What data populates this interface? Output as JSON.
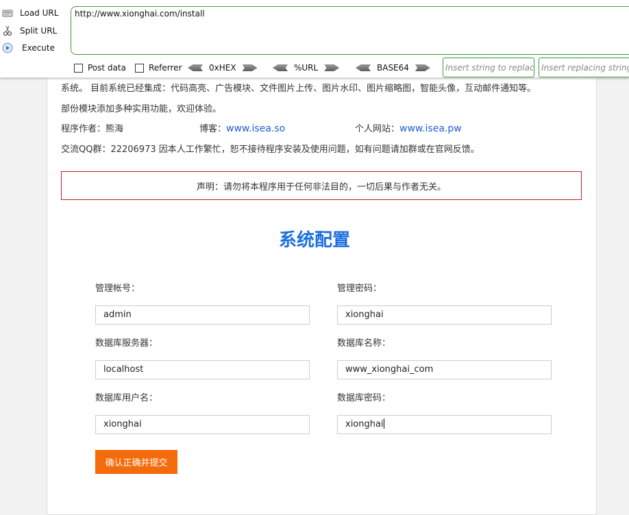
{
  "hackbar": {
    "load_url": "Load URL",
    "split_url": "Split URL",
    "execute": "Execute",
    "url_value": "http://www.xionghai.com/install",
    "post_data": "Post data",
    "referrer": "Referrer",
    "hex": "0xHEX",
    "url_enc": "%URL",
    "base64": "BASE64",
    "replace_placeholder": "Insert string to replace",
    "replacing_placeholder": "Insert replacing string"
  },
  "intro": {
    "line1": "系统。 目前系统已经集成：代码高亮、广告模块、文件图片上传、图片水印、图片缩略图，智能头像，互动邮件通知等。",
    "line2": "部份模块添加多种实用功能，欢迎体验。",
    "author_label": "程序作者：熊海",
    "blog_label": "博客：",
    "blog_link": "www.isea.so",
    "site_label": "个人网站：",
    "site_link": "www.isea.pw",
    "qq_line": "交流QQ群：22206973 因本人工作繁忙，恕不接待程序安装及使用问题，如有问题请加群或在官网反馈。"
  },
  "notice": "声明：请勿将本程序用于任何非法目的，一切后果与作者无关。",
  "config": {
    "title": "系统配置",
    "admin_user_label": "管理帐号：",
    "admin_user_value": "admin",
    "admin_pass_label": "管理密码：",
    "admin_pass_value": "xionghai",
    "db_host_label": "数据库服务器：",
    "db_host_value": "localhost",
    "db_name_label": "数据库名称：",
    "db_name_value": "www_xionghai_com",
    "db_user_label": "数据库用户名：",
    "db_user_value": "xionghai",
    "db_pass_label": "数据库密码：",
    "db_pass_value": "xionghai",
    "submit": "确认正确并提交"
  },
  "colors": {
    "accent": "#1c6fe0",
    "submit": "#f36b0a",
    "notice_border": "#c21b1b",
    "hackbar_border": "#3a9a3a"
  }
}
